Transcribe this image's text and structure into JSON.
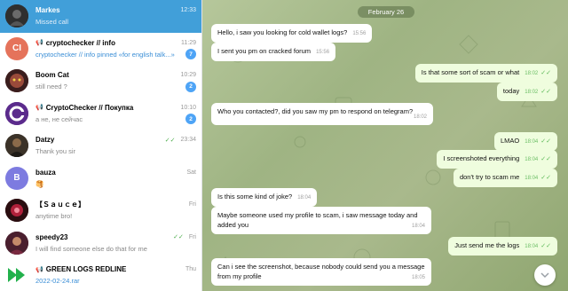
{
  "sidebar": {
    "chats": [
      {
        "name": "Markes",
        "time": "12:33",
        "preview": "Missed call",
        "avatar_color": "#2f2f2f",
        "active": true
      },
      {
        "name": "cryptochecker // info",
        "time": "11:29",
        "preview": "cryptochecker // info pinned «for english talk...»",
        "badge": "7",
        "avatar_text": "CI",
        "avatar_color": "#e5735b",
        "channel": true
      },
      {
        "name": "Boom Cat",
        "time": "10:29",
        "preview": "still need ?",
        "badge": "2",
        "avatar_color": "#6b2d2d"
      },
      {
        "name": "CryptoChecker // Покупка",
        "time": "10:10",
        "preview": "а не, не сейчас",
        "badge": "2",
        "avatar_text": "C",
        "avatar_color": "#5b2b8c",
        "channel": true
      },
      {
        "name": "Datzy",
        "time": "23:34",
        "preview": "Thank you sir",
        "read": true,
        "avatar_color": "#3b3228"
      },
      {
        "name": "bauza",
        "time": "Sat",
        "preview": "🥞",
        "avatar_text": "B",
        "avatar_color": "#7d7be0"
      },
      {
        "name": "【Ｓａｕｃｅ】",
        "time": "Fri",
        "preview": "anytime bro!",
        "avatar_color": "#3a1418"
      },
      {
        "name": "speedy23",
        "time": "Fri",
        "preview": "I will find someone else do that for me",
        "read": true,
        "avatar_color": "#5a2a3a"
      },
      {
        "name": "GREEN LOGS REDLINE",
        "time": "Thu",
        "preview": "2022-02-24.rar",
        "avatar_color": "#ffffff",
        "channel": true,
        "preview_link": true
      }
    ]
  },
  "conversation": {
    "date": "February 26",
    "messages": [
      {
        "dir": "in",
        "text": "Hello, i saw you looking for cold wallet logs?",
        "time": "15:56"
      },
      {
        "dir": "in",
        "text": "I sent you pm on cracked forum",
        "time": "15:56"
      },
      {
        "dir": "out",
        "text": "Is that some sort of scam or what",
        "time": "18:02"
      },
      {
        "dir": "out",
        "text": "today",
        "time": "18:02"
      },
      {
        "dir": "in",
        "text": "Who you contacted?, did you saw my pm to respond on telegram?",
        "time": "18:02"
      },
      {
        "dir": "out",
        "text": "LMAO",
        "time": "18:04"
      },
      {
        "dir": "out",
        "text": "I screenshoted everything",
        "time": "18:04"
      },
      {
        "dir": "out",
        "text": "don't try to scam me",
        "time": "18:04"
      },
      {
        "dir": "in",
        "text": "Is this some kind of joke?",
        "time": "18:04"
      },
      {
        "dir": "in",
        "text": "Maybe someone used my profile to scam, i saw message today and added you",
        "time": "18:04"
      },
      {
        "dir": "out",
        "text": "Just send me the logs",
        "time": "18:04"
      },
      {
        "dir": "in",
        "text": "Can i see the screenshot, because nobody could send you a message from my profile",
        "time": "18:05"
      }
    ]
  },
  "colors": {
    "accent": "#419fd9",
    "badge": "#4ea4f6",
    "outgoing": "#effdde"
  }
}
